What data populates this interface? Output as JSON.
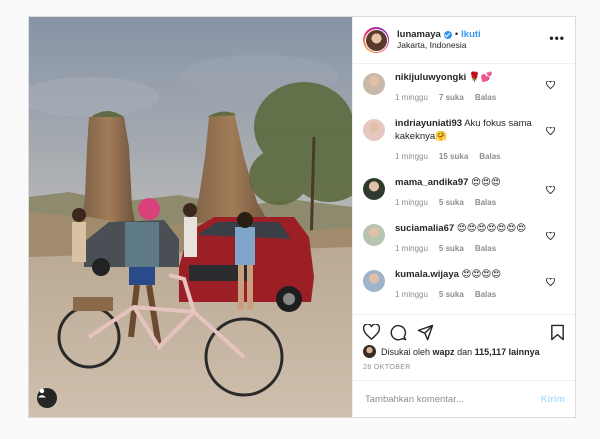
{
  "header": {
    "username": "lunamaya",
    "separator": "•",
    "follow_label": "Ikuti",
    "location": "Jakarta, Indonesia",
    "more_label": "•••"
  },
  "comments": [
    {
      "user": "nikijuluwyongki",
      "text": "🌹💕",
      "time": "1 minggu",
      "likes": "7 suka",
      "reply": "Balas",
      "avatar_color": "#c8b8a8"
    },
    {
      "user": "indriayuniati93",
      "text": "Aku fokus sama kakeknya🤗",
      "time": "1 minggu",
      "likes": "15 suka",
      "reply": "Balas",
      "avatar_color": "#e6c8c0"
    },
    {
      "user": "mama_andika97",
      "text": "😍😍😍",
      "time": "1 minggu",
      "likes": "5 suka",
      "reply": "Balas",
      "avatar_color": "#2f3a2f"
    },
    {
      "user": "suciamalia67",
      "text": "😍😍😍😍😍😍😍",
      "time": "1 minggu",
      "likes": "5 suka",
      "reply": "Balas",
      "avatar_color": "#b7c4b0"
    },
    {
      "user": "kumala.wijaya",
      "text": "😍😍😍😍",
      "time": "1 minggu",
      "likes": "5 suka",
      "reply": "Balas",
      "avatar_color": "#9fb4c8"
    }
  ],
  "actions": {
    "liked_by_prefix": "Disukai oleh",
    "liked_by_user": "wapz",
    "liked_by_mid": "dan",
    "likes_count": "115,117 lainnya",
    "date": "28 OKTOBER"
  },
  "add_comment": {
    "placeholder": "Tambahkan komentar...",
    "post_label": "Kirim"
  },
  "colors": {
    "link_blue": "#3897f0",
    "disabled_blue": "#b2dffc",
    "meta_gray": "#8e8e8e"
  }
}
